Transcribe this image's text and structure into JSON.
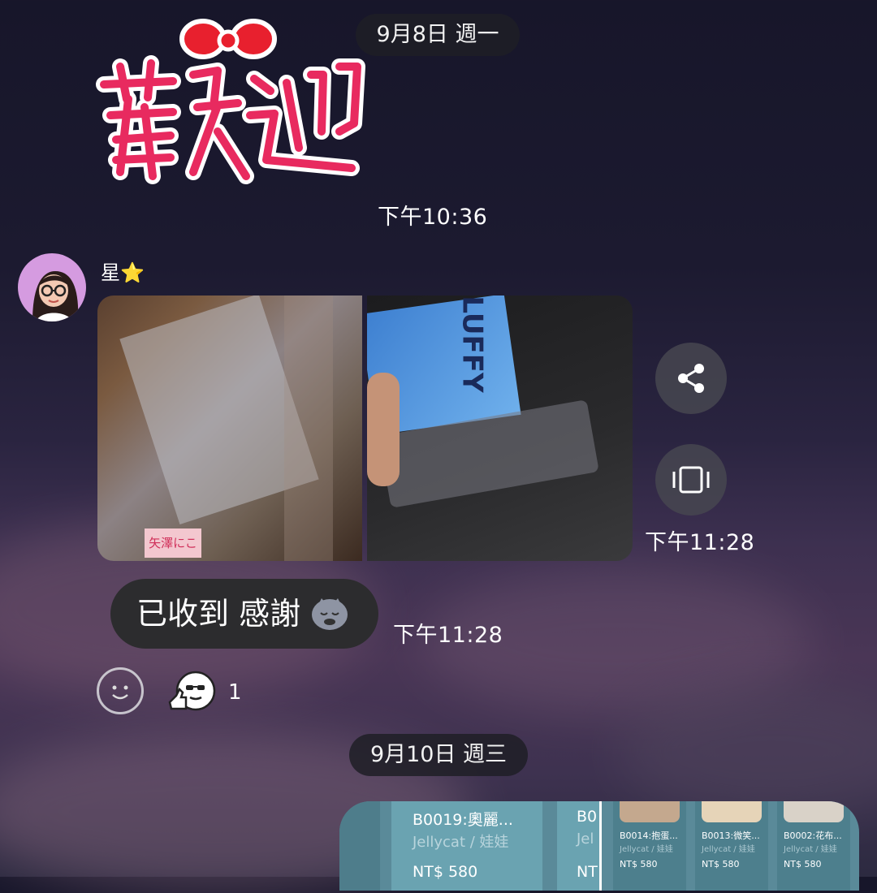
{
  "chat": {
    "date_1": "9月8日 週一",
    "sticker_time": "下午10:36",
    "sender_name": "星⭐",
    "photos_time": "下午11:28",
    "message_text": "已收到 感謝",
    "message_time": "下午11:28",
    "reaction_count": "1",
    "date_2": "9月10日 週三"
  },
  "carousel": {
    "main_card": {
      "title": "B0019:奧麗...",
      "subtitle": "Jellycat / 娃娃",
      "price": "NT$ 580"
    },
    "partial_card": {
      "title": "B0",
      "subtitle": "Jel",
      "price": "NT"
    },
    "small_cards": [
      {
        "title": "B0014:抱蛋...",
        "subtitle": "Jellycat / 娃娃",
        "price": "NT$ 580"
      },
      {
        "title": "B0013:微笑...",
        "subtitle": "Jellycat / 娃娃",
        "price": "NT$ 580"
      },
      {
        "title": "B0002:花布...",
        "subtitle": "Jellycat / 娃娃",
        "price": "NT$ 580"
      }
    ]
  },
  "photo_text": {
    "box_label": "矢澤にこ",
    "book_title": "LUFFY"
  },
  "icons": [
    "share-icon",
    "carousel-view-icon",
    "smiley-icon",
    "thumbs-up-reaction-icon"
  ],
  "colors": {
    "bubble": "#2c2c2e",
    "pill": "#1e1e26",
    "carousel": "#5a8a99"
  }
}
